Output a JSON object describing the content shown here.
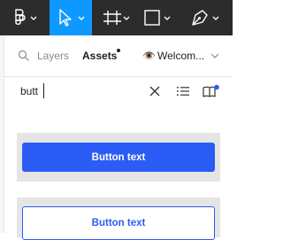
{
  "toolbar": {
    "tools": [
      "main-menu",
      "move-tool",
      "frame-tool",
      "shape-tool",
      "pen-tool"
    ],
    "active_tool": "move-tool",
    "active_color": "#0d99ff"
  },
  "tabs": {
    "layers_label": "Layers",
    "assets_label": "Assets",
    "assets_has_update": true,
    "file_emoji": "👁️",
    "file_label": "Welcom..."
  },
  "search": {
    "value": "butt"
  },
  "results": {
    "primary_button_label": "Button text",
    "secondary_button_label": "Button text",
    "accent_color": "#2c5cf6"
  }
}
